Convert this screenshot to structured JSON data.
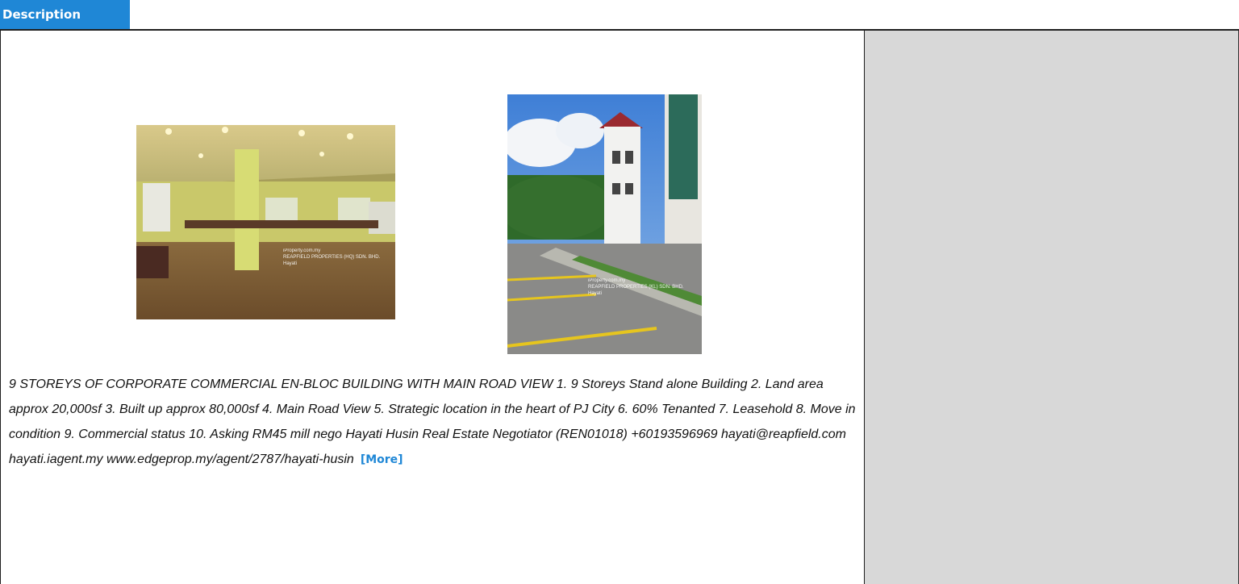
{
  "tab": {
    "label": "Description"
  },
  "photos": [
    {
      "watermark_site": "iProperty.com.my",
      "watermark_agency": "REAPFIELD PROPERTIES (HQ) SDN. BHD.",
      "watermark_agent": "Hayati"
    },
    {
      "watermark_site": "iProperty.com.my",
      "watermark_agency": "REAPFIELD PROPERTIES (KL) SDN. BHD.",
      "watermark_agent": "Hayati"
    }
  ],
  "description": {
    "text": "9 STOREYS OF CORPORATE COMMERCIAL EN-BLOC BUILDING WITH MAIN ROAD VIEW  1. 9 Storeys Stand alone Building 2. Land area approx 20,000sf 3. Built up approx 80,000sf 4. Main Road View 5. Strategic location in the heart of PJ City 6. 60% Tenanted 7. Leasehold 8. Move in condition 9. Commercial status 10. Asking RM45 mill nego  Hayati Husin  Real Estate Negotiator (REN01018) +60193596969 hayati@reapfield.com hayati.iagent.my www.edgeprop.my/agent/2787/hayati-husin",
    "more_label": "[More]"
  },
  "colors": {
    "accent": "#1f87d6",
    "sidebar": "#d8d8d8"
  }
}
